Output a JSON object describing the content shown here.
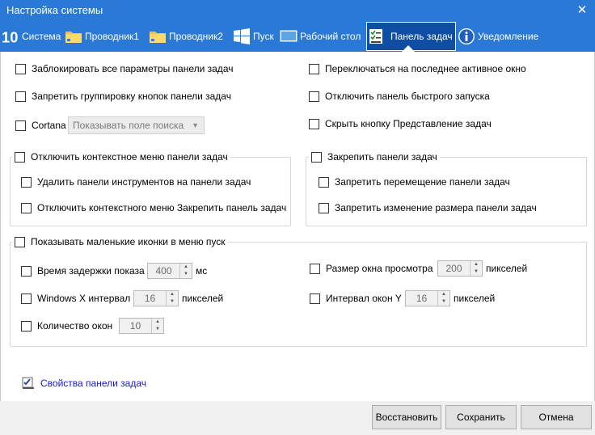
{
  "window": {
    "title": "Настройка системы",
    "close_glyph": "✕"
  },
  "tabs": [
    {
      "label": "Система",
      "icon": "win10-icon"
    },
    {
      "label": "Проводник1",
      "icon": "folder-icon"
    },
    {
      "label": "Проводник2",
      "icon": "folder-icon"
    },
    {
      "label": "Пуск",
      "icon": "windows-logo-icon"
    },
    {
      "label": "Рабочий стол",
      "icon": "desktop-icon"
    },
    {
      "label": "Панель задач",
      "icon": "taskbar-icon",
      "active": true
    },
    {
      "label": "Уведомление",
      "icon": "info-icon"
    }
  ],
  "options": {
    "lock_all": "Заблокировать все параметры панели задач",
    "switch_last_window": "Переключаться на последнее активное окно",
    "disable_grouping": "Запретить группировку кнопок панели задач",
    "disable_quick_launch": "Отключить панель быстрого запуска",
    "cortana": "Cortana",
    "cortana_select": "Показывать поле поиска",
    "hide_task_view": "Скрыть кнопку Представление задач"
  },
  "context_menu_group": {
    "title": "Отключить контекстное меню панели задач",
    "remove_toolbars": "Удалить панели инструментов на панели задач",
    "disable_pin_menu": "Отключить контекстного меню Закрепить панель задач"
  },
  "lock_group": {
    "title": "Закрепить панели задач",
    "no_move": "Запретить перемещение панели задач",
    "no_resize": "Запретить изменение размера панели задач"
  },
  "icons_group": {
    "title": "Показывать маленькие иконки в меню пуск",
    "delay_label": "Время задержки показа",
    "delay_value": "400",
    "delay_unit": "мс",
    "preview_label": "Размер окна просмотра",
    "preview_value": "200",
    "preview_unit": "пикселей",
    "x_label": "Windows X интервал",
    "x_value": "16",
    "x_unit": "пикселей",
    "y_label": "Интервал окон Y",
    "y_value": "16",
    "y_unit": "пикселей",
    "count_label": "Количество окон",
    "count_value": "10"
  },
  "properties_link": "Свойства панели задач",
  "buttons": {
    "restore": "Восстановить",
    "save": "Сохранить",
    "cancel": "Отмена"
  },
  "colors": {
    "titlebar": "#2b79d6",
    "active_tab": "#0f4ea5",
    "link": "#1a1acc"
  }
}
